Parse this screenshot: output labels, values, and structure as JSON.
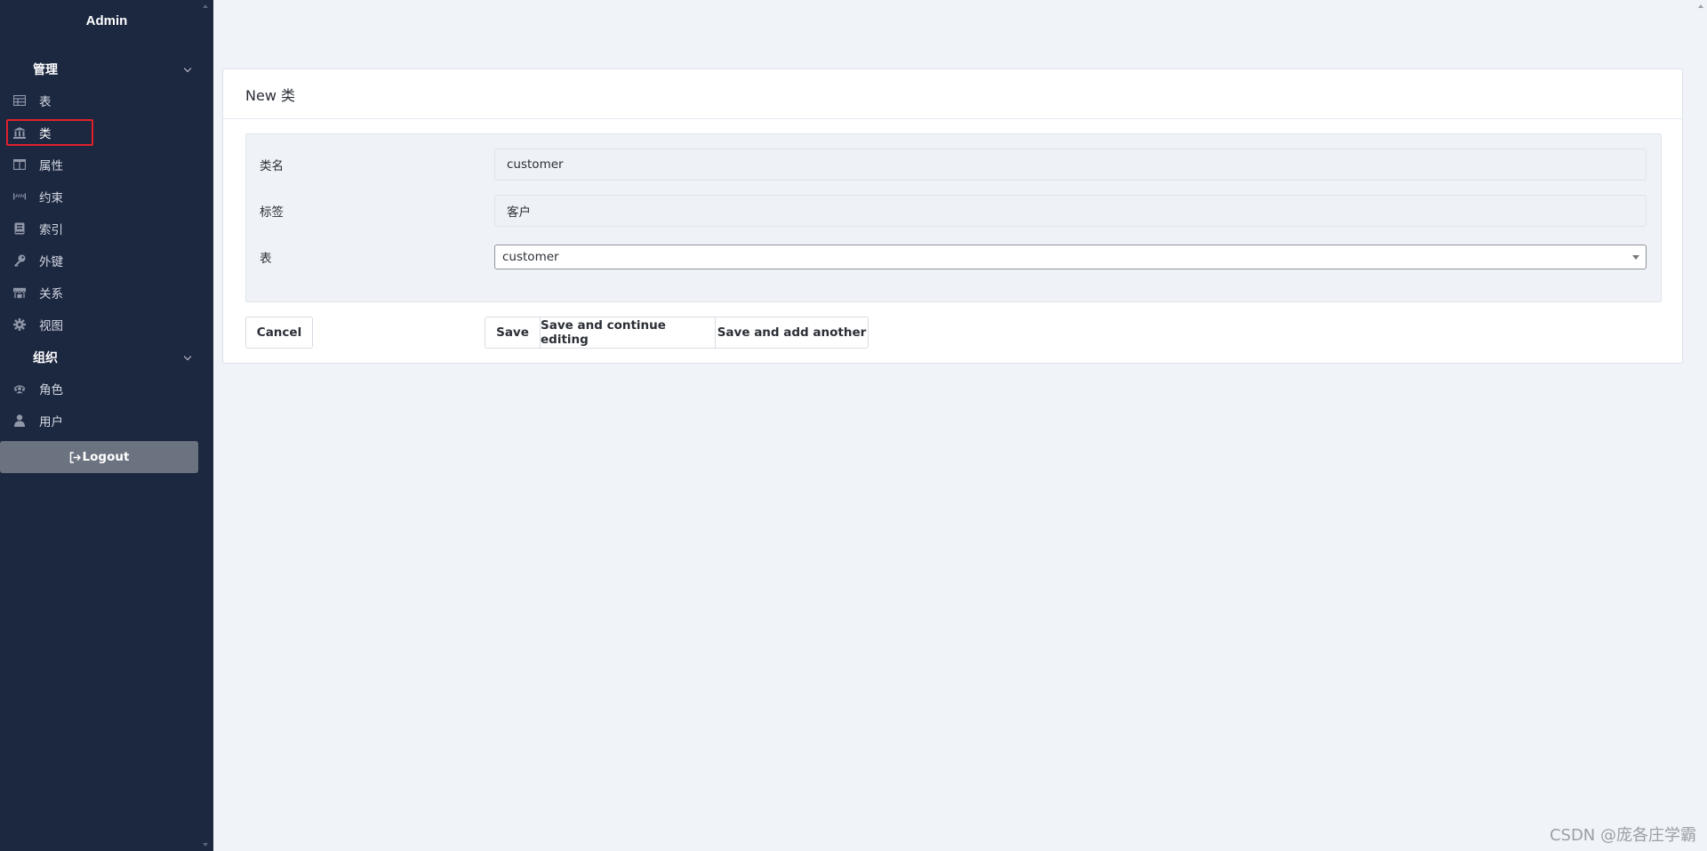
{
  "sidebar": {
    "brand": "Admin",
    "groups": [
      {
        "label": "管理",
        "items": [
          {
            "label": "表",
            "icon": "table-icon"
          },
          {
            "label": "类",
            "icon": "bank-icon",
            "selected": true
          },
          {
            "label": "属性",
            "icon": "columns-icon"
          },
          {
            "label": "约束",
            "icon": "ruler-icon"
          },
          {
            "label": "索引",
            "icon": "book-icon"
          },
          {
            "label": "外键",
            "icon": "key-icon"
          },
          {
            "label": "关系",
            "icon": "store-icon"
          },
          {
            "label": "视图",
            "icon": "gear-icon"
          }
        ]
      },
      {
        "label": "组织",
        "items": [
          {
            "label": "角色",
            "icon": "users-icon"
          },
          {
            "label": "用户",
            "icon": "user-icon"
          }
        ]
      }
    ],
    "logout_label": "Logout"
  },
  "form": {
    "title": "New 类",
    "fields": [
      {
        "label": "类名",
        "value": "customer"
      },
      {
        "label": "标签",
        "value": "客户"
      },
      {
        "label": "表",
        "value": "customer"
      }
    ],
    "cancel_label": "Cancel",
    "save_label": "Save",
    "save_continue_label": "Save and continue editing",
    "save_add_label": "Save and add another"
  },
  "watermark": "CSDN @庞各庄学霸",
  "colors": {
    "sidebar_bg": "#1c2740",
    "page_bg": "#f0f3f8",
    "selected_outline": "#e0202a",
    "logout_bg": "#6c7380"
  }
}
